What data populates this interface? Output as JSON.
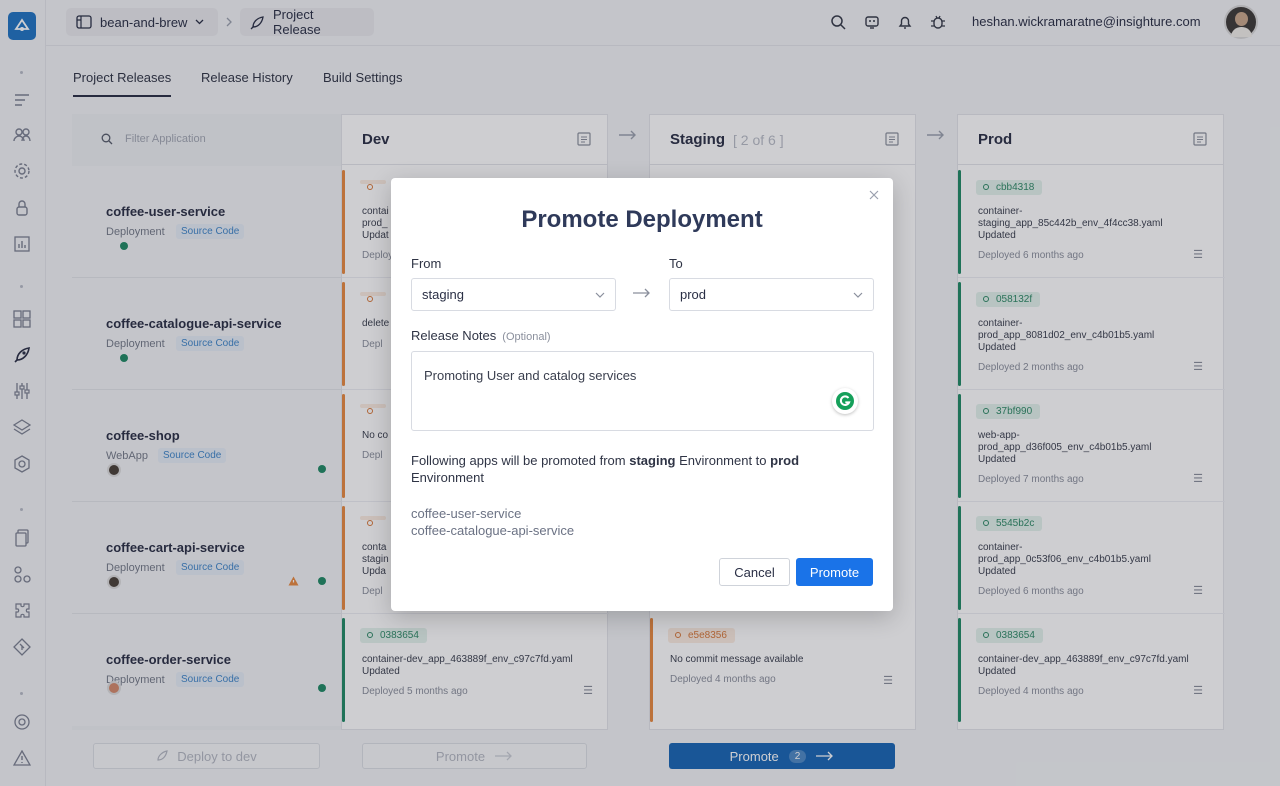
{
  "topbar": {
    "workspace": "bean-and-brew",
    "page": "Project Release",
    "user_email": "heshan.wickramaratne@insighture.com"
  },
  "tabs": [
    "Project Releases",
    "Release History",
    "Build Settings"
  ],
  "filter": {
    "placeholder": "Filter Application"
  },
  "apps": [
    {
      "name": "coffee-user-service",
      "type": "Deployment",
      "tag": "Source Code"
    },
    {
      "name": "coffee-catalogue-api-service",
      "type": "Deployment",
      "tag": "Source Code"
    },
    {
      "name": "coffee-shop",
      "type": "WebApp",
      "tag": "Source Code"
    },
    {
      "name": "coffee-cart-api-service",
      "type": "Deployment",
      "tag": "Source Code"
    },
    {
      "name": "coffee-order-service",
      "type": "Deployment",
      "tag": "Source Code"
    }
  ],
  "envs": {
    "dev": {
      "title": "Dev",
      "cards": [
        {
          "commit": "",
          "line1": "contai prod_ Updat",
          "deployed": "Deploy"
        },
        {
          "commit": "",
          "line1": "delete",
          "deployed": "Depl"
        },
        {
          "commit": "",
          "line1": "No co",
          "deployed": "Depl"
        },
        {
          "commit": "",
          "line1": "conta stagin Upda",
          "deployed": "Depl"
        },
        {
          "commit": "0383654",
          "line1": "container-dev_app_463889f_env_c97c7fd.yaml Updated",
          "deployed": "Deployed 5 months ago"
        }
      ]
    },
    "staging": {
      "title": "Staging",
      "count": "[ 2 of 6 ]",
      "cards": [
        {
          "commit": "e5e8356",
          "line1": "No commit message available",
          "deployed": "Deployed 4 months ago"
        }
      ]
    },
    "prod": {
      "title": "Prod",
      "cards": [
        {
          "commit": "cbb4318",
          "line1": "container-staging_app_85c442b_env_4f4cc38.yaml Updated",
          "deployed": "Deployed 6 months ago"
        },
        {
          "commit": "058132f",
          "line1": "container-prod_app_8081d02_env_c4b01b5.yaml Updated",
          "deployed": "Deployed 2 months ago"
        },
        {
          "commit": "37bf990",
          "line1": "web-app-prod_app_d36f005_env_c4b01b5.yaml Updated",
          "deployed": "Deployed 7 months ago"
        },
        {
          "commit": "5545b2c",
          "line1": "container-prod_app_0c53f06_env_c4b01b5.yaml Updated",
          "deployed": "Deployed 6 months ago"
        },
        {
          "commit": "0383654",
          "line1": "container-dev_app_463889f_env_c97c7fd.yaml Updated",
          "deployed": "Deployed 4 months ago"
        }
      ]
    }
  },
  "bottom": {
    "deploy_dev": "Deploy to dev",
    "promote_dev": "Promote",
    "promote_staging": "Promote",
    "promote_staging_count": "2"
  },
  "modal": {
    "title": "Promote Deployment",
    "from_label": "From",
    "to_label": "To",
    "from_value": "staging",
    "to_value": "prod",
    "notes_label": "Release Notes",
    "notes_optional": "(Optional)",
    "notes_value": "Promoting User and catalog services",
    "summary_pre": "Following apps will be promoted from",
    "summary_from": "staging",
    "summary_mid": "Environment to",
    "summary_to": "prod",
    "summary_post": "Environment",
    "apps": [
      "coffee-user-service",
      "coffee-catalogue-api-service"
    ],
    "cancel": "Cancel",
    "promote": "Promote"
  },
  "colors": {
    "accent": "#1a73e8",
    "green": "#1f8a64",
    "orange": "#e8893f",
    "brand": "#1f74c3"
  }
}
